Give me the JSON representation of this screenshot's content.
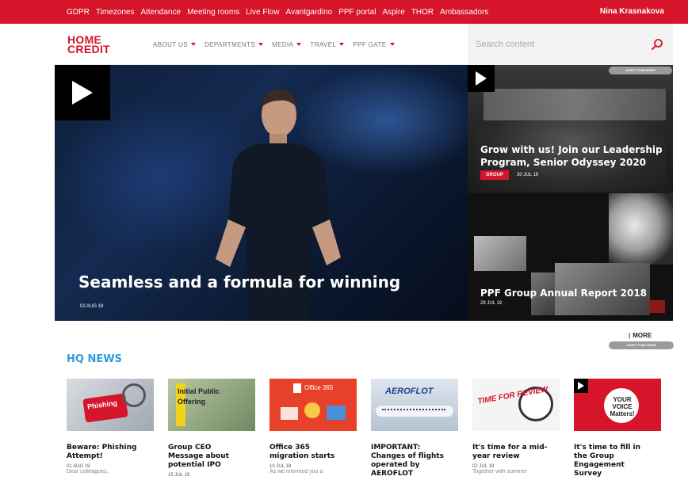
{
  "topbar": {
    "links": [
      "GDPR",
      "Timezones",
      "Attendance",
      "Meeting rooms",
      "Live Flow",
      "Avantgardino",
      "PPF portal",
      "Aspire",
      "THOR",
      "Ambassadors"
    ],
    "user_name": "Nina Krasnakova"
  },
  "logo": {
    "line1": "HOME",
    "line2": "CREDIT"
  },
  "mainnav": [
    "ABOUT US",
    "DEPARTMENTS",
    "MEDIA",
    "TRAVEL",
    "PPF GATE"
  ],
  "search": {
    "placeholder": "Search content"
  },
  "hero": {
    "title": "Seamless and a formula for winning",
    "date": "02 AUG 19"
  },
  "side_cards": [
    {
      "title_line1": "Grow with us! Join our Leadership",
      "title_line2": "Program, Senior Odyssey 2020",
      "tag": "GROUP",
      "date": "30 JUL 19",
      "asset_label": "ASSET PUBLISHER"
    },
    {
      "title": "PPF Group Annual Report 2018",
      "date": "29 JUL 19"
    }
  ],
  "more": {
    "label": "MORE",
    "asset_label": "ASSET PUBLISHER"
  },
  "hq_news": {
    "title": "HQ NEWS",
    "items": [
      {
        "title": [
          "Beware: Phishing",
          "Attempt!"
        ],
        "date": "01 AUG 19",
        "excerpt": "Dear colleagues,",
        "thumb_text": "Phishing"
      },
      {
        "title": [
          "Group CEO",
          "Message about",
          "potential IPO"
        ],
        "date": "15 JUL 19",
        "excerpt": "",
        "thumb_text": "Initial Public Offering"
      },
      {
        "title": [
          "Office 365",
          "migration starts"
        ],
        "date": "10 JUL 19",
        "excerpt": "As we informed you a",
        "thumb_text": "Office 365"
      },
      {
        "title": [
          "IMPORTANT:",
          "Changes of flights",
          "operated by",
          "AEROFLOT"
        ],
        "date": "",
        "excerpt": "",
        "thumb_text": "AEROFLOT"
      },
      {
        "title": [
          "It's time for a mid-",
          "year review"
        ],
        "date": "02 JUL 19",
        "excerpt": "Together with summer",
        "thumb_text": "TIME FOR REVIEW"
      },
      {
        "title": [
          "It's time to fill in",
          "the Group",
          "Engagement",
          "Survey"
        ],
        "date": "",
        "excerpt": "",
        "thumb_text": "YOUR VOICE Matters!"
      }
    ]
  },
  "colors": {
    "brand_red": "#d6142a",
    "hq_blue": "#2a9fd8"
  }
}
